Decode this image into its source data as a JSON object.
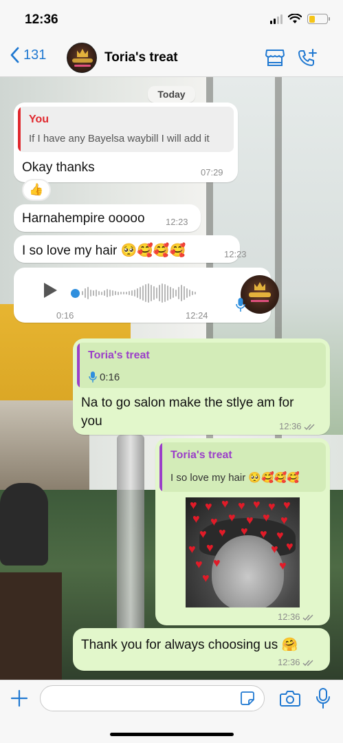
{
  "status_bar": {
    "time": "12:36",
    "battery_level": 0.35
  },
  "header": {
    "back_count": "131",
    "contact_name": "Toria's treat",
    "icons": [
      "chevron-left-icon",
      "store-icon",
      "add-call-icon"
    ]
  },
  "chat": {
    "date_chip": "Today",
    "messages": [
      {
        "direction": "incoming",
        "quote_author": "You",
        "quote_text": "If I have any Bayelsa waybill I will add it",
        "text": "Okay thanks",
        "time": "07:29",
        "reaction": "👍"
      },
      {
        "direction": "incoming",
        "text": "Harnahempire ooooo",
        "time": "12:23"
      },
      {
        "direction": "incoming",
        "text": "I so love my hair 🥺🥰🥰🥰",
        "time": "12:23"
      },
      {
        "direction": "incoming",
        "type": "voice",
        "duration": "0:16",
        "time": "12:24"
      },
      {
        "direction": "outgoing",
        "quote_author": "Toria's treat",
        "quote_text": "0:16",
        "text_line1": "Na to go salon make the stlye am for",
        "text_line2": "you",
        "time": "12:36"
      },
      {
        "direction": "outgoing",
        "type": "image",
        "quote_author": "Toria's treat",
        "quote_text": "I so love my hair 🥺🥰🥰🥰",
        "time": "12:36"
      },
      {
        "direction": "outgoing",
        "text": "Thank you for always choosing us 🤗",
        "time": "12:36"
      }
    ]
  },
  "input_bar": {
    "value": "",
    "placeholder": ""
  },
  "colors": {
    "accent": "#1f78d1",
    "incoming_bubble": "#ffffff",
    "outgoing_bubble": "#e2f7cb",
    "quote_you": "#e0282e",
    "quote_contact": "#9b3fc9"
  }
}
